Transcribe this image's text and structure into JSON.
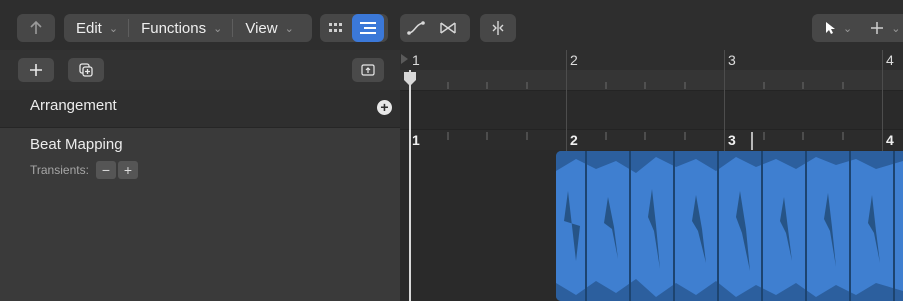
{
  "toolbar": {
    "menus": [
      {
        "label": "Edit"
      },
      {
        "label": "Functions"
      },
      {
        "label": "View"
      }
    ],
    "chevron": "⌄"
  },
  "inspector": {
    "arrangement_label": "Arrangement",
    "beat_mapping_label": "Beat Mapping",
    "transients_label": "Transients:",
    "minus": "−",
    "plus": "+"
  },
  "ruler": {
    "bars_top": [
      "1",
      "2",
      "3",
      "4"
    ],
    "bars_beat": [
      "1",
      "2",
      "3",
      "4"
    ]
  },
  "colors": {
    "accent": "#3b78d8",
    "region": "#2c5f9e",
    "waveform": "#3f7fd0"
  }
}
